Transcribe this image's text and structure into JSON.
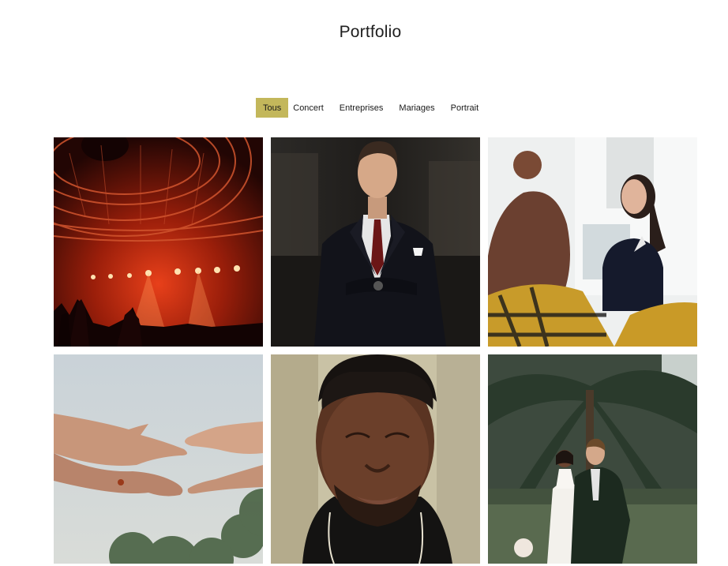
{
  "page": {
    "title": "Portfolio"
  },
  "filters": [
    {
      "label": "Tous",
      "active": true
    },
    {
      "label": "Concert",
      "active": false
    },
    {
      "label": "Entreprises",
      "active": false
    },
    {
      "label": "Mariages",
      "active": false
    },
    {
      "label": "Portrait",
      "active": false
    }
  ],
  "colors": {
    "accent": "#c3b75b",
    "background": "#ffffff",
    "text": "#222222"
  },
  "gallery": {
    "images": [
      {
        "subject": "concert-stage-photo",
        "category": "Concert"
      },
      {
        "subject": "businessman-suit-photo",
        "category": "Entreprises"
      },
      {
        "subject": "office-meeting-photo",
        "category": "Entreprises"
      },
      {
        "subject": "reaching-hands-photo",
        "category": "Mariages"
      },
      {
        "subject": "man-portrait-photo",
        "category": "Portrait"
      },
      {
        "subject": "wedding-couple-photo",
        "category": "Mariages"
      }
    ]
  }
}
